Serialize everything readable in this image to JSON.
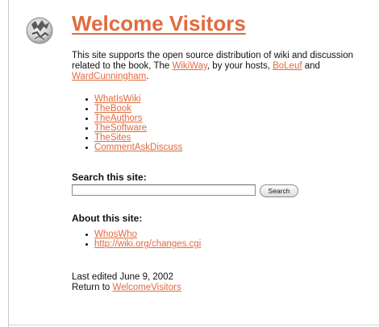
{
  "page": {
    "title": "Welcome Visitors"
  },
  "intro": {
    "line1": "This site supports the open source distribution of wiki and discussion",
    "line2_prefix": "related to the book, The ",
    "wikiway_link": "WikiWay",
    "line2_middle": ", by your hosts, ",
    "boleuf_link": "BoLeuf",
    "line2_and": " and",
    "ward_link": "WardCunningham",
    "line3_suffix": "."
  },
  "nav": {
    "items": [
      {
        "label": "WhatIsWiki"
      },
      {
        "label": "TheBook"
      },
      {
        "label": "TheAuthors"
      },
      {
        "label": "TheSoftware"
      },
      {
        "label": "TheSites"
      },
      {
        "label": "CommentAskDiscuss"
      }
    ]
  },
  "search": {
    "heading": "Search this site:",
    "value": "",
    "button_label": "Search"
  },
  "about": {
    "heading": "About this site:",
    "items": [
      {
        "label": "WhosWho"
      },
      {
        "label": "http://wiki.org/changes.cgi"
      }
    ]
  },
  "footer": {
    "last_edited": "Last edited June 9, 2002",
    "return_prefix": "Return to ",
    "return_link": "WelcomeVisitors"
  },
  "colors": {
    "link": "#e26a3f",
    "text": "#111111",
    "background": "#ffffff"
  },
  "icons": {
    "logo": "wiki-logo-icon"
  }
}
